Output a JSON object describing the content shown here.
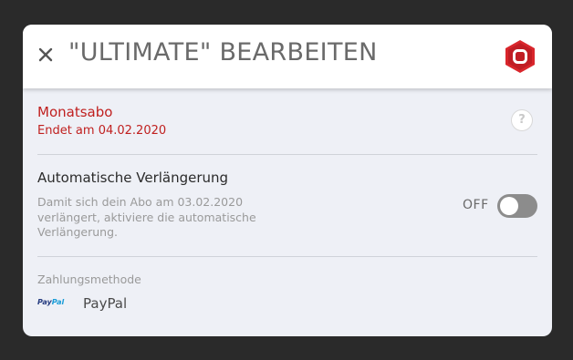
{
  "dialog": {
    "title": "\"ULTIMATE\" BEARBEITEN",
    "close_icon": "close-icon",
    "logo_icon": "hexagon-logo-icon",
    "brand_color": "#d9262c"
  },
  "plan": {
    "name": "Monatsabo",
    "ends": "Endet am 04.02.2020",
    "help_label": "?",
    "accent_color": "#c0201f"
  },
  "renewal": {
    "title": "Automatische Verlängerung",
    "description": "Damit sich dein Abo am 03.02.2020 verlängert, aktiviere die automatische Verlängerung.",
    "toggle_label": "OFF",
    "enabled": false
  },
  "payment": {
    "label": "Zahlungsmethode",
    "method_logo_part1": "Pay",
    "method_logo_part2": "Pal",
    "method_name": "PayPal"
  }
}
